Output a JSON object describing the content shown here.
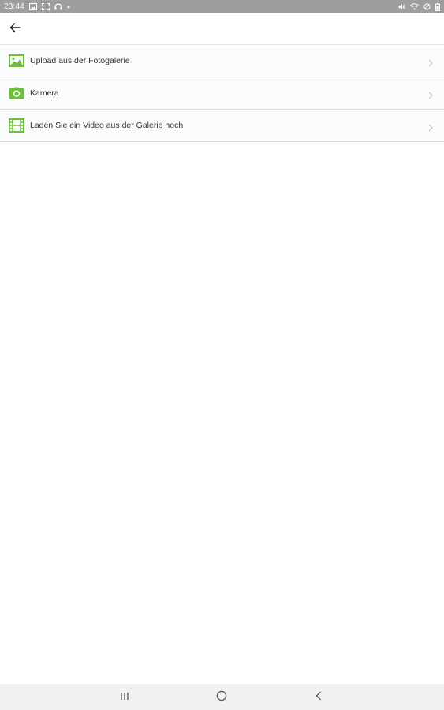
{
  "status_bar": {
    "time": "23:44",
    "left_icons": [
      "gallery-icon",
      "screenshot-icon",
      "headphones-icon",
      "dot-icon"
    ],
    "right_icons": [
      "mute-icon",
      "wifi-icon",
      "alarm-icon",
      "battery-icon"
    ]
  },
  "app_bar": {
    "back_icon": "arrow-left-icon"
  },
  "menu": {
    "items": [
      {
        "icon": "image-icon",
        "label": "Upload aus der Fotogalerie"
      },
      {
        "icon": "camera-icon",
        "label": "Kamera"
      },
      {
        "icon": "film-icon",
        "label": "Laden Sie ein Video aus der Galerie hoch"
      }
    ]
  },
  "nav_bar": {
    "buttons": [
      "recent-apps-icon",
      "home-icon",
      "back-icon"
    ]
  },
  "colors": {
    "accent_green": "#6cbf3a",
    "status_bar": "#9e9e9e",
    "list_background": "#fafbfd",
    "divider": "#dcdcdc",
    "nav_bar": "#f1f1f1"
  }
}
